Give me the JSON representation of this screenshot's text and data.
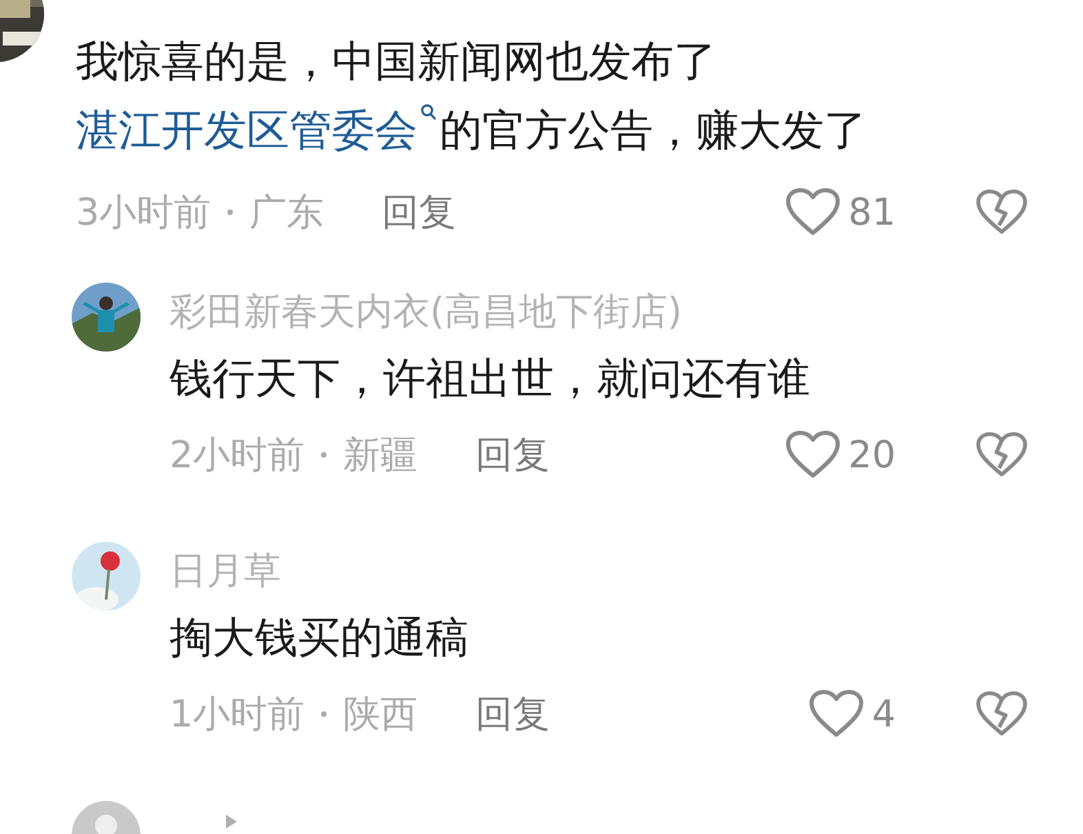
{
  "comments": [
    {
      "lines": [
        [
          {
            "kind": "text",
            "text": "我惊喜的是，中国新闻网也发布了"
          }
        ],
        [
          {
            "kind": "link",
            "text": "湛江开发区管委会"
          },
          {
            "kind": "text",
            "text": "的官方公告，赚大发了"
          }
        ]
      ],
      "time": "3小时前",
      "location": "广东",
      "reply_label": "回复",
      "likes": "81"
    },
    {
      "author": "彩田新春天内衣(高昌地下街店)",
      "avatar": {
        "kind": "picture"
      },
      "lines": [
        [
          {
            "kind": "text",
            "text": "钱行天下，许祖出世，就问还有谁"
          }
        ]
      ],
      "time": "2小时前",
      "location": "新疆",
      "reply_label": "回复",
      "likes": "20"
    },
    {
      "author": "日月草",
      "avatar": {
        "kind": "picture"
      },
      "lines": [
        [
          {
            "kind": "text",
            "text": "掏大钱买的通稿"
          }
        ]
      ],
      "time": "1小时前",
      "location": "陕西",
      "reply_label": "回复",
      "likes": "4"
    }
  ],
  "partial_reply": {
    "avatar": {
      "kind": "picture"
    }
  }
}
